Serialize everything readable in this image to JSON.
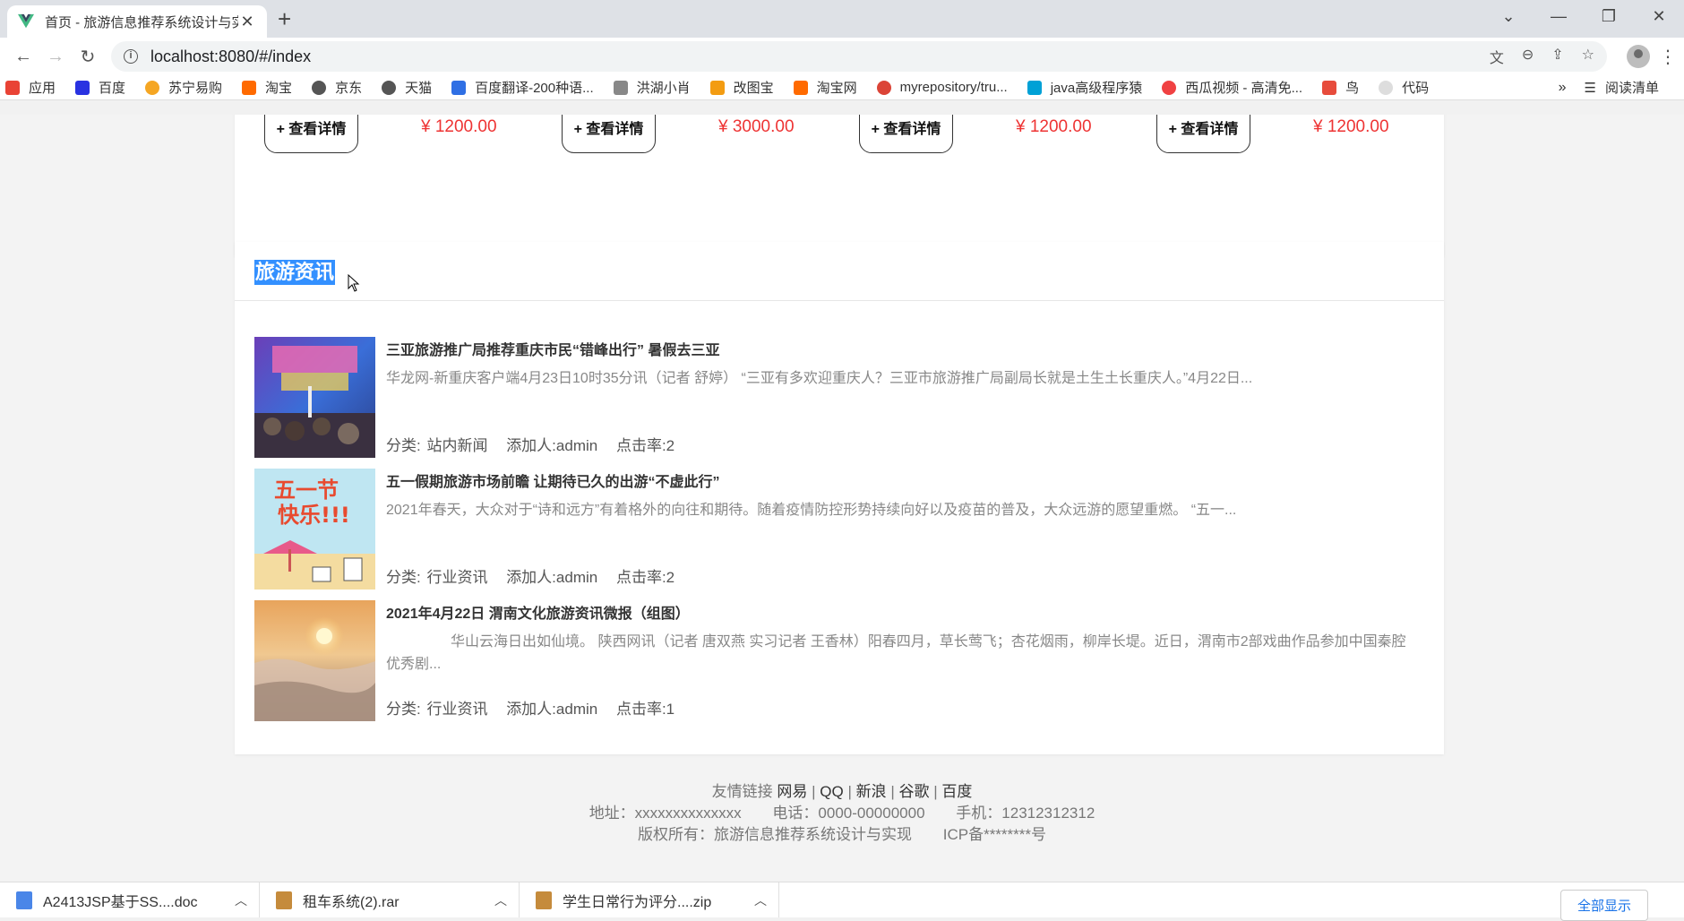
{
  "browser": {
    "tab_title": "首页 - 旅游信息推荐系统设计与实",
    "url": "localhost:8080/#/index",
    "bookmarks": [
      {
        "label": "应用",
        "color": "#e94335"
      },
      {
        "label": "百度",
        "color": "#2932e1"
      },
      {
        "label": "苏宁易购",
        "color": "#f5a623"
      },
      {
        "label": "淘宝",
        "color": "#ff6a00"
      },
      {
        "label": "京东",
        "color": "#555555"
      },
      {
        "label": "天猫",
        "color": "#555555"
      },
      {
        "label": "百度翻译-200种语...",
        "color": "#2f6fe4"
      },
      {
        "label": "洪湖小肖",
        "color": "#888888"
      },
      {
        "label": "改图宝",
        "color": "#f39c12"
      },
      {
        "label": "淘宝网",
        "color": "#ff6a00"
      },
      {
        "label": "myrepository/tru...",
        "color": "#db4437"
      },
      {
        "label": "java高级程序猿",
        "color": "#00a1d6"
      },
      {
        "label": "西瓜视频 - 高清免...",
        "color": "#f04142"
      },
      {
        "label": "鸟",
        "color": "#e74c3c"
      },
      {
        "label": "代码",
        "color": "#dddddd"
      }
    ],
    "bookmarks_more": "»",
    "reading_list": "阅读清单"
  },
  "products": [
    {
      "button": "+ 查看详情",
      "price": "¥ 1200.00"
    },
    {
      "button": "+ 查看详情",
      "price": "¥ 3000.00"
    },
    {
      "button": "+ 查看详情",
      "price": "¥ 1200.00"
    },
    {
      "button": "+ 查看详情",
      "price": "¥ 1200.00"
    }
  ],
  "news": {
    "heading": "旅游资讯",
    "items": [
      {
        "title": "三亚旅游推广局推荐重庆市民“错峰出行” 暑假去三亚",
        "desc": "华龙网-新重庆客户端4月23日10时35分讯（记者 舒婷） “三亚有多欢迎重庆人？三亚市旅游推广局副局长就是土生土长重庆人。”4月22日...",
        "category": "分类: 站内新闻",
        "author": "添加人:admin",
        "clicks": "点击率:2"
      },
      {
        "title": "五一假期旅游市场前瞻 让期待已久的出游“不虚此行”",
        "desc": "2021年春天，大众对于“诗和远方”有着格外的向往和期待。随着疫情防控形势持续向好以及疫苗的普及，大众远游的愿望重燃。 “五一...",
        "category": "分类: 行业资讯",
        "author": "添加人:admin",
        "clicks": "点击率:2"
      },
      {
        "title": "2021年4月22日 渭南文化旅游资讯微报（组图）",
        "desc": "华山云海日出如仙境。 陕西网讯（记者 唐双燕 实习记者 王香林）阳春四月，草长莺飞；杏花烟雨，柳岸长堤。近日，渭南市2部戏曲作品参加中国秦腔优秀剧...",
        "category": "分类: 行业资讯",
        "author": "添加人:admin",
        "clicks": "点击率:1"
      }
    ]
  },
  "footer": {
    "links_label": "友情链接",
    "links": [
      "网易",
      "QQ",
      "新浪",
      "谷歌",
      "百度"
    ],
    "address": "地址：xxxxxxxxxxxxxx",
    "phone": "电话：0000-00000000",
    "mobile": "手机：12312312312",
    "copyright": "版权所有：旅游信息推荐系统设计与实现",
    "icp": "ICP备********号"
  },
  "downloads": [
    {
      "name": "A2413JSP基于SS....doc",
      "color": "#4a86e8"
    },
    {
      "name": "租车系统(2).rar",
      "color": "#c58b3c"
    },
    {
      "name": "学生日常行为评分....zip",
      "color": "#c58b3c"
    }
  ],
  "downloads_show_all": "全部显示"
}
